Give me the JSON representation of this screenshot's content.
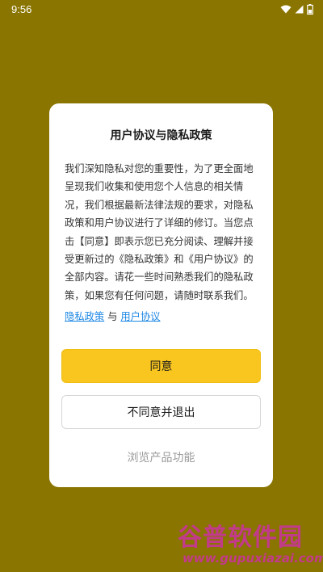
{
  "status_bar": {
    "time": "9:56",
    "icons": [
      "wifi-icon",
      "signal-icon",
      "battery-icon"
    ]
  },
  "dialog": {
    "title": "用户协议与隐私政策",
    "lines": [
      "我们深知隐私对您的重要性，为了更全面地",
      "呈现我们收集和使用您个人信息的相关情",
      "况，我们根据最新法律法规的要求，对隐私",
      "政策和用户协议进行了详细的修订。当您点",
      "击【同意】即表示您已充分阅读、理解并接",
      "受更新过的《隐私政策》和《用户协议》的",
      "全部内容。请花一些时间熟悉我们的隐私政",
      "策，如果您有任何问题，请随时联系我们。"
    ],
    "privacy_link": "隐私政策",
    "link_separator": "与",
    "user_agreement_link": "用户协议",
    "agree_button": "同意",
    "decline_button": "不同意并退出",
    "browse_link": "浏览产品功能"
  },
  "watermark": {
    "top": "谷普软件园",
    "bottom": "www.gupuxiazai.com"
  },
  "colors": {
    "background": "#8a7500",
    "accent": "#f9c61f",
    "link": "#1e88e5"
  }
}
